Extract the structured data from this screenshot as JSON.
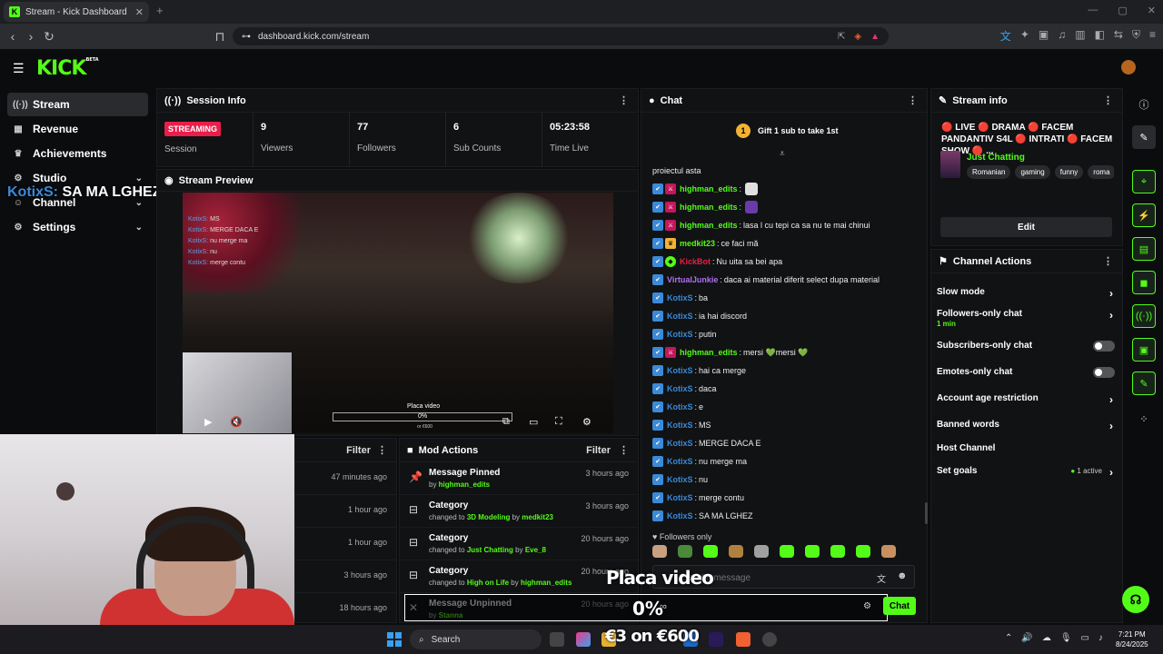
{
  "browser": {
    "tab_title": "Stream - Kick Dashboard",
    "url": "dashboard.kick.com/stream"
  },
  "header": {
    "logo": "KICK",
    "logo_sup": "BETA"
  },
  "nav": {
    "items": [
      {
        "label": "Stream",
        "icon": "broadcast-icon"
      },
      {
        "label": "Revenue",
        "icon": "money-icon"
      },
      {
        "label": "Achievements",
        "icon": "trophy-icon"
      },
      {
        "label": "Studio",
        "icon": "gear-icon"
      },
      {
        "label": "Channel",
        "icon": "user-icon"
      },
      {
        "label": "Settings",
        "icon": "gear-icon"
      }
    ]
  },
  "overlay_chat": {
    "user": "KotixS:",
    "text": "SA MA LGHEZ"
  },
  "session": {
    "title": "Session Info",
    "status": "STREAMING",
    "status_label": "Session",
    "stats": [
      {
        "value": "9",
        "label": "Viewers"
      },
      {
        "value": "77",
        "label": "Followers"
      },
      {
        "value": "6",
        "label": "Sub Counts"
      },
      {
        "value": "05:23:58",
        "label": "Time Live"
      }
    ]
  },
  "preview": {
    "title": "Stream Preview",
    "video_chat": [
      {
        "user": "KotixS:",
        "text": "MS"
      },
      {
        "user": "KotixS:",
        "text": "MERGE DACA E"
      },
      {
        "user": "KotixS:",
        "text": "nu merge ma"
      },
      {
        "user": "KotixS:",
        "text": "nu"
      },
      {
        "user": "KotixS:",
        "text": "merge contu"
      }
    ],
    "goal_title": "Placa video",
    "goal_pct": "0%",
    "goal_price": "or €600"
  },
  "activity": {
    "filter": "Filter",
    "times": [
      "47 minutes ago",
      "1 hour ago",
      "1 hour ago",
      "3 hours ago",
      "18 hours ago"
    ]
  },
  "mod_actions": {
    "title": "Mod Actions",
    "filter": "Filter",
    "rows": [
      {
        "action": "Message Pinned",
        "pre": "by",
        "target": "highman_edits",
        "mid": "",
        "by": "",
        "time": "3 hours ago",
        "icon": "pin-icon"
      },
      {
        "action": "Category",
        "pre": "changed to",
        "target": "3D Modeling",
        "mid": "by",
        "by": "medkit23",
        "time": "3 hours ago",
        "icon": "category-icon"
      },
      {
        "action": "Category",
        "pre": "changed to",
        "target": "Just Chatting",
        "mid": "by",
        "by": "Eve_8",
        "time": "20 hours ago",
        "icon": "category-icon"
      },
      {
        "action": "Category",
        "pre": "changed to",
        "target": "High on Life",
        "mid": "by",
        "by": "highman_edits",
        "time": "20 hours ago",
        "icon": "category-icon"
      },
      {
        "action": "Message Unpinned",
        "pre": "by",
        "target": "Stanna",
        "mid": "",
        "by": "",
        "time": "20 hours ago",
        "icon": "unpin-icon"
      }
    ]
  },
  "chat": {
    "title": "Chat",
    "gift_text": "Gift 1 sub to take 1st",
    "gift_count": "1",
    "messages": [
      {
        "badges": [],
        "user": "",
        "color": "#ffffff",
        "text": "proiectul asta",
        "emote": ""
      },
      {
        "badges": [
          "v",
          "m"
        ],
        "user": "highman_edits",
        "color": "#53fc18",
        "text": "",
        "emote": "#e0e0e0"
      },
      {
        "badges": [
          "v",
          "m"
        ],
        "user": "highman_edits",
        "color": "#53fc18",
        "text": "",
        "emote": "#6a3aaa"
      },
      {
        "badges": [
          "v",
          "m"
        ],
        "user": "highman_edits",
        "color": "#53fc18",
        "text": "lasa l cu tepi ca sa nu te mai chinui",
        "emote": ""
      },
      {
        "badges": [
          "v",
          "c"
        ],
        "user": "medkit23",
        "color": "#53fc18",
        "text": "ce faci mă",
        "emote": ""
      },
      {
        "badges": [
          "v",
          "g"
        ],
        "user": "KickBot",
        "color": "#e91e4a",
        "text": "Nu uita sa bei apa",
        "emote": ""
      },
      {
        "badges": [
          "v"
        ],
        "user": "VirtualJunkie",
        "color": "#b070f0",
        "text": "daca ai material diferit select dupa material",
        "emote": ""
      },
      {
        "badges": [
          "v"
        ],
        "user": "KotixS",
        "color": "#3a8ad8",
        "text": "ba",
        "emote": ""
      },
      {
        "badges": [
          "v"
        ],
        "user": "KotixS",
        "color": "#3a8ad8",
        "text": "ia hai discord",
        "emote": ""
      },
      {
        "badges": [
          "v"
        ],
        "user": "KotixS",
        "color": "#3a8ad8",
        "text": "putin",
        "emote": ""
      },
      {
        "badges": [
          "v",
          "m"
        ],
        "user": "highman_edits",
        "color": "#53fc18",
        "text": "mersi 💚mersi 💚",
        "emote": ""
      },
      {
        "badges": [
          "v"
        ],
        "user": "KotixS",
        "color": "#3a8ad8",
        "text": "hai ca merge",
        "emote": ""
      },
      {
        "badges": [
          "v"
        ],
        "user": "KotixS",
        "color": "#3a8ad8",
        "text": "daca",
        "emote": ""
      },
      {
        "badges": [
          "v"
        ],
        "user": "KotixS",
        "color": "#3a8ad8",
        "text": "e",
        "emote": ""
      },
      {
        "badges": [
          "v"
        ],
        "user": "KotixS",
        "color": "#3a8ad8",
        "text": "MS",
        "emote": ""
      },
      {
        "badges": [
          "v"
        ],
        "user": "KotixS",
        "color": "#3a8ad8",
        "text": "MERGE DACA E",
        "emote": ""
      },
      {
        "badges": [
          "v"
        ],
        "user": "KotixS",
        "color": "#3a8ad8",
        "text": "nu merge ma",
        "emote": ""
      },
      {
        "badges": [
          "v"
        ],
        "user": "KotixS",
        "color": "#3a8ad8",
        "text": "nu",
        "emote": ""
      },
      {
        "badges": [
          "v"
        ],
        "user": "KotixS",
        "color": "#3a8ad8",
        "text": "merge contu",
        "emote": ""
      },
      {
        "badges": [
          "v"
        ],
        "user": "KotixS",
        "color": "#3a8ad8",
        "text": "SA MA LGHEZ",
        "emote": ""
      }
    ],
    "followers_only": "♥ Followers only",
    "emote_colors": [
      "#c8a080",
      "#4a8a3a",
      "#53fc18",
      "#b08040",
      "#a0a0a0",
      "#53fc18",
      "#53fc18",
      "#53fc18",
      "#53fc18",
      "#c89060"
    ],
    "input_placeholder": "Send a message",
    "send_label": "Chat"
  },
  "goal_overlay": {
    "title": "Placa video",
    "pct_value": 0,
    "pct": "0%",
    "price": "€3 on €600"
  },
  "stream_info": {
    "title": "Stream info",
    "stream_title": "🔴 LIVE 🔴 DRAMA 🔴 FACEM PANDANTIV S4L 🔴 INTRATI 🔴 FACEM SHOW 🔴 ...",
    "category": "Just Chatting",
    "tags": [
      "Romanian",
      "gaming",
      "funny",
      "roma"
    ],
    "edit_label": "Edit"
  },
  "channel_actions": {
    "title": "Channel Actions",
    "items": [
      {
        "label": "Slow mode",
        "type": "chevron",
        "sub": ""
      },
      {
        "label": "Followers-only chat",
        "type": "chevron",
        "sub": "1 min"
      },
      {
        "label": "Subscribers-only chat",
        "type": "toggle",
        "sub": ""
      },
      {
        "label": "Emotes-only chat",
        "type": "toggle",
        "sub": ""
      },
      {
        "label": "Account age restriction",
        "type": "chevron",
        "sub": ""
      },
      {
        "label": "Banned words",
        "type": "chevron",
        "sub": ""
      },
      {
        "label": "Host Channel",
        "type": "none",
        "sub": ""
      },
      {
        "label": "Set goals",
        "type": "chevron",
        "sub": "",
        "active": "1 active"
      }
    ]
  },
  "taskbar": {
    "search": "Search",
    "time": "7:21 PM",
    "date": "8/24/2025"
  },
  "colors": {
    "accent": "#53fc18",
    "live": "#e91e4a",
    "bg": "#0b0c0e"
  }
}
